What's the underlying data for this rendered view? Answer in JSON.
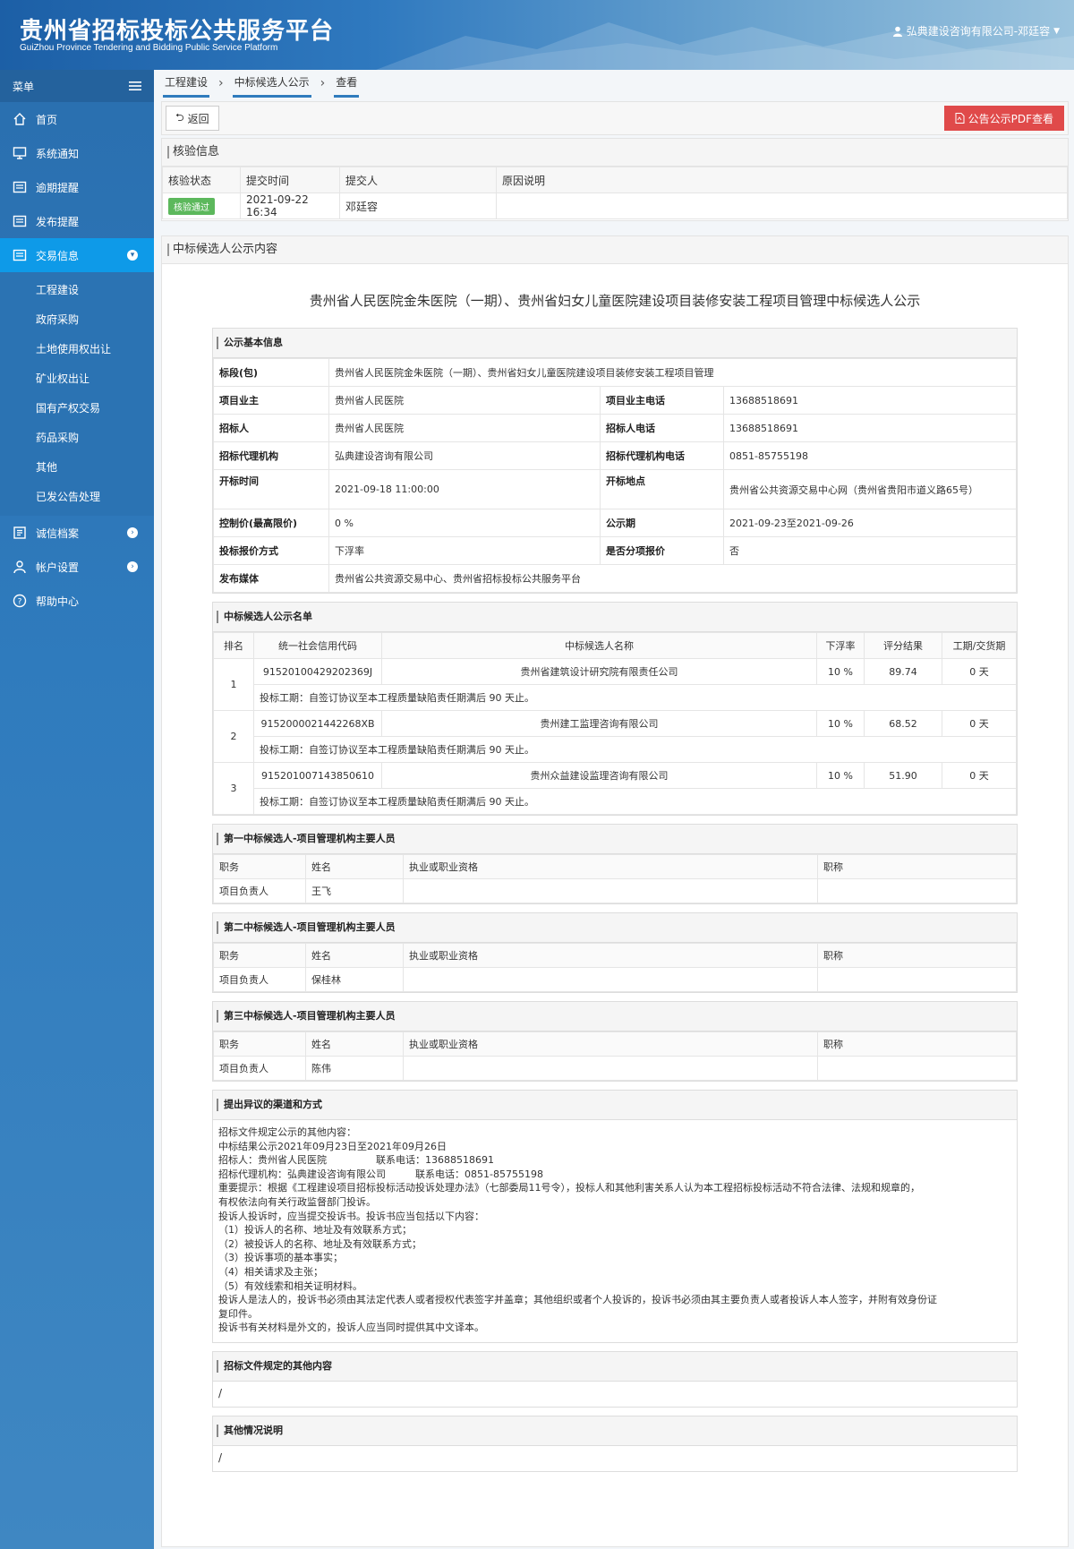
{
  "header": {
    "title": "贵州省招标投标公共服务平台",
    "subtitle": "GuiZhou Province Tendering and Bidding Public Service Platform",
    "user": "弘典建设咨询有限公司-邓廷容"
  },
  "sidebar": {
    "menu_label": "菜单",
    "items": [
      {
        "label": "首页",
        "icon": "home-icon"
      },
      {
        "label": "系统通知",
        "icon": "monitor-icon"
      },
      {
        "label": "逾期提醒",
        "icon": "list-icon"
      },
      {
        "label": "发布提醒",
        "icon": "list-icon"
      },
      {
        "label": "交易信息",
        "icon": "list-icon"
      }
    ],
    "sub_items": [
      "工程建设",
      "政府采购",
      "土地使用权出让",
      "矿业权出让",
      "国有产权交易",
      "药品采购",
      "其他",
      "已发公告处理"
    ],
    "bottom_items": [
      {
        "label": "诚信档案",
        "icon": "document-icon"
      },
      {
        "label": "帐户设置",
        "icon": "user-icon"
      },
      {
        "label": "帮助中心",
        "icon": "help-icon"
      }
    ]
  },
  "breadcrumb": [
    "工程建设",
    "中标候选人公示",
    "查看"
  ],
  "toolbar": {
    "back": "返回",
    "pdf": "公告公示PDF查看"
  },
  "verify": {
    "title": "核验信息",
    "headers": [
      "核验状态",
      "提交时间",
      "提交人",
      "原因说明"
    ],
    "status": "核验通过",
    "time": "2021-09-22 16:34",
    "submitter": "邓廷容",
    "reason": ""
  },
  "content": {
    "panel_title": "中标候选人公示内容",
    "doc_title": "贵州省人民医院金朱医院（一期）、贵州省妇女儿童医院建设项目装修安装工程项目管理中标候选人公示"
  },
  "basic": {
    "title": "公示基本信息",
    "section_label": "标段(包)",
    "section_value": "贵州省人民医院金朱医院（一期）、贵州省妇女儿童医院建设项目装修安装工程项目管理",
    "owner_label": "项目业主",
    "owner": "贵州省人民医院",
    "owner_tel_label": "项目业主电话",
    "owner_tel": "13688518691",
    "tenderer_label": "招标人",
    "tenderer": "贵州省人民医院",
    "tenderer_tel_label": "招标人电话",
    "tenderer_tel": "13688518691",
    "agent_label": "招标代理机构",
    "agent": "弘典建设咨询有限公司",
    "agent_tel_label": "招标代理机构电话",
    "agent_tel": "0851-85755198",
    "open_time_label": "开标时间",
    "open_time": "2021-09-18 11:00:00",
    "open_place_label": "开标地点",
    "open_place": "贵州省公共资源交易中心网（贵州省贵阳市道义路65号）",
    "price_label": "控制价(最高限价)",
    "price": "0 %",
    "period_label": "公示期",
    "period": "2021-09-23至2021-09-26",
    "method_label": "投标报价方式",
    "method": "下浮率",
    "split_label": "是否分项报价",
    "split": "否",
    "media_label": "发布媒体",
    "media": "贵州省公共资源交易中心、贵州省招标投标公共服务平台"
  },
  "candidates": {
    "title": "中标候选人公示名单",
    "headers": [
      "排名",
      "统一社会信用代码",
      "中标候选人名称",
      "下浮率",
      "评分结果",
      "工期/交货期"
    ],
    "rows": [
      {
        "rank": "1",
        "code": "91520100429202369J",
        "name": "贵州省建筑设计研究院有限责任公司",
        "rate": "10 %",
        "score": "89.74",
        "period": "0 天",
        "note": "投标工期：自签订协议至本工程质量缺陷责任期满后 90 天止。"
      },
      {
        "rank": "2",
        "code": "9152000021442268XB",
        "name": "贵州建工监理咨询有限公司",
        "rate": "10 %",
        "score": "68.52",
        "period": "0 天",
        "note": "投标工期：自签订协议至本工程质量缺陷责任期满后 90 天止。"
      },
      {
        "rank": "3",
        "code": "915201007143850610",
        "name": "贵州众益建设监理咨询有限公司",
        "rate": "10 %",
        "score": "51.90",
        "period": "0 天",
        "note": "投标工期：自签订协议至本工程质量缺陷责任期满后 90 天止。"
      }
    ]
  },
  "personnel": {
    "headers": [
      "职务",
      "姓名",
      "执业或职业资格",
      "职称"
    ],
    "groups": [
      {
        "title": "第一中标候选人-项目管理机构主要人员",
        "role": "项目负责人",
        "name": "王飞",
        "qual": "",
        "rank": ""
      },
      {
        "title": "第二中标候选人-项目管理机构主要人员",
        "role": "项目负责人",
        "name": "保桂林",
        "qual": "",
        "rank": ""
      },
      {
        "title": "第三中标候选人-项目管理机构主要人员",
        "role": "项目负责人",
        "name": "陈伟",
        "qual": "",
        "rank": ""
      }
    ]
  },
  "objection": {
    "title": "提出异议的渠道和方式",
    "lines": [
      "招标文件规定公示的其他内容：",
      "中标结果公示2021年09月23日至2021年09月26日",
      "招标人：贵州省人民医院　　　　　联系电话：13688518691",
      "招标代理机构：弘典建设咨询有限公司　　　联系电话：0851-85755198",
      "重要提示：根据《工程建设项目招标投标活动投诉处理办法》（七部委局11号令），投标人和其他利害关系人认为本工程招标投标活动不符合法律、法规和规章的，",
      "有权依法向有关行政监督部门投诉。",
      "投诉人投诉时，应当提交投诉书。投诉书应当包括以下内容：",
      "（1）投诉人的名称、地址及有效联系方式；",
      "（2）被投诉人的名称、地址及有效联系方式；",
      "（3）投诉事项的基本事实；",
      "（4）相关请求及主张；",
      "（5）有效线索和相关证明材料。",
      "投诉人是法人的，投诉书必须由其法定代表人或者授权代表签字并盖章；其他组织或者个人投诉的，投诉书必须由其主要负责人或者投诉人本人签字，并附有效身份证",
      "复印件。",
      "投诉书有关材料是外文的，投诉人应当同时提供其中文译本。"
    ]
  },
  "other_docs": {
    "title": "招标文件规定的其他内容",
    "value": "/"
  },
  "other_notes": {
    "title": "其他情况说明",
    "value": "/"
  }
}
